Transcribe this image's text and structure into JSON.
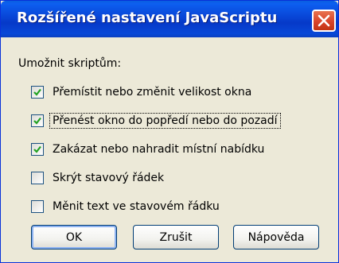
{
  "dialog": {
    "title": "Rozšířené nastavení JavaScriptu",
    "group_label": "Umožnit skriptům:",
    "options": [
      {
        "label": "Přemístit nebo změnit velikost okna",
        "checked": true
      },
      {
        "label": "Přenést okno do popředí nebo do pozadí",
        "checked": true
      },
      {
        "label": "Zakázat nebo nahradit místní nabídku",
        "checked": true
      },
      {
        "label": "Skrýt stavový řádek",
        "checked": false
      },
      {
        "label": "Měnit text ve stavovém řádku",
        "checked": false
      }
    ],
    "buttons": {
      "ok": "OK",
      "cancel": "Zrušit",
      "help": "Nápověda"
    }
  },
  "icons": {
    "close": "close-icon",
    "check": "checkmark-icon"
  },
  "colors": {
    "title_bar": "#0845d6",
    "close_button": "#d9442a",
    "dialog_bg": "#ece9d8",
    "checkmark": "#21a121"
  }
}
